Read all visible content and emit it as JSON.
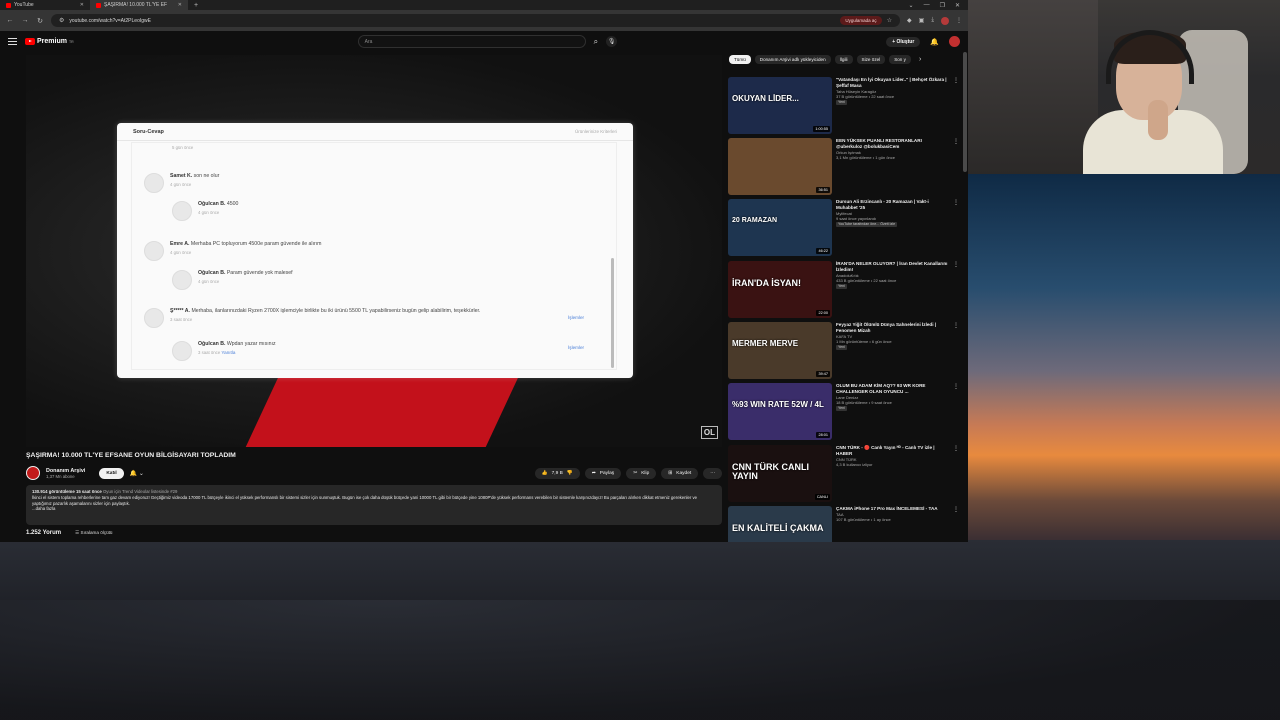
{
  "browser": {
    "tabs": [
      {
        "label": "YouTube",
        "active": false
      },
      {
        "label": "ŞAŞIRMA! 10.000 TL'YE EF",
        "active": true
      }
    ],
    "new_tab": "+",
    "window_controls": [
      "⌄",
      "—",
      "❐",
      "✕"
    ],
    "url": "youtube.com/watch?v=At2PLeoIgwE",
    "app_pill": "Uygulamada aç"
  },
  "header": {
    "brand": "Premium",
    "brand_sup": "TR",
    "search_placeholder": "Ara",
    "create_label": "+ Oluştur"
  },
  "player": {
    "qa": {
      "title": "Soru-Cevap",
      "header_link": "Ürünlerinize Kriterleri",
      "items": [
        {
          "name": "",
          "text": "",
          "time": "5 gün önce"
        },
        {
          "name": "Samet K.",
          "text": "son ne olur",
          "time": "4 gün önce"
        },
        {
          "name": "Oğulcan B.",
          "text": "4500",
          "time": "4 gün önce"
        },
        {
          "name": "Emre A.",
          "text": "Merhaba PC topluyorum 4500e param güvende ile alırım",
          "time": "4 gün önce"
        },
        {
          "name": "Oğulcan B.",
          "text": "Param güvende yok malesef",
          "time": "4 gün önce"
        },
        {
          "name": "Ş***** A.",
          "text": "Merhaba, ilanlarınızdaki Ryzen 2700X işlemciyle birlikte bu iki ürünü 5500 TL yapabilirseniz bugün gelip alabilirim, teşekkürler.",
          "time": "3 saat önce"
        },
        {
          "name": "Oğulcan B.",
          "text": "Wpdan yazar mısınız",
          "time": "3 saat önce"
        }
      ],
      "reply_label": "Yanıtla",
      "replies_label": "İşlemler"
    },
    "overlay_logo": "OL"
  },
  "video": {
    "title": "ŞAŞIRMA! 10.000 TL'YE EFSANE OYUN BİLGİSAYARI TOPLADIM",
    "channel": "Donanım Arşivi",
    "subs": "1,37 Mn abone",
    "join": "Katıl",
    "likes": "7,9 B",
    "share": "Paylaş",
    "clip": "Klip",
    "save": "Kaydet",
    "views_meta": "130.914 görüntüleme  15 saat önce",
    "trend_tag": "Oyun için Trend Videolar listesinde #29",
    "description": "İkinci el sistem toplama rehberlerine tam gaz devam ediyoruz! Geçtiğimiz videoda 17000 TL bütçeyle ikinci el yüksek performanslı bir sistemi sizler için sunmuştuk. Bugün ise çok daha düşük bütçede yani 10000 TL gibi bir bütçede yine 1080P'de yüksek performans verebilen bir sistemle karşınızdayız! Bu parçaları alırken dikkat etmeniz gerekenler ve yaptığımız pazarlık aşamalarını sizler için paylaştık.",
    "more": "...daha fazla",
    "comments_count": "1.252 Yorum",
    "sort_label": "Sıralama ölçütü"
  },
  "chips": [
    "Tümü",
    "Donanım Arşivi adlı yükleyiciden",
    "İlgili",
    "Size özel",
    "Son y"
  ],
  "recommendations": [
    {
      "title": "\"Vatandaşı En İyi Okuyan Lider..\" | Behçet Özkara | Şeffaf Masa",
      "channel": "Taha Hüseyin Karagöz",
      "meta": "37 B görüntüleme • 22 saat önce",
      "badge": "Yeni",
      "duration": "1:00:55",
      "thumb_text": "OKUYAN LİDER...",
      "bg": "#1d2a4a"
    },
    {
      "title": "EEN YÜKSEK PUANLI RESTORANLARI @uberkuloz @bolukbasiCem",
      "channel": "Orkun Işıtmak",
      "meta": "3,1 Mn görüntüleme • 1 gün önce",
      "badge": "",
      "duration": "36:51",
      "thumb_text": "",
      "bg": "#6a4a2e"
    },
    {
      "title": "Dursun Ali Erzincanlı - 20 Ramazan | Vakt-i Muhabbet '25",
      "channel": "Mylifecat",
      "meta": "9 saat önce yayınlandı",
      "badge": "YouTube tarafından öne... Özeti izle",
      "duration": "46:22",
      "thumb_text": "20 RAMAZAN",
      "bg": "#1e3550"
    },
    {
      "title": "İRAN'DA NELER OLUYOR? | İran Devlet Kanallarını İzledim!",
      "channel": "AnadoluKıtık",
      "meta": "433 B görüntüleme • 22 saat önce",
      "badge": "Yeni",
      "duration": "22:00",
      "thumb_text": "İRAN'DA İSYAN!",
      "bg": "#3a1212"
    },
    {
      "title": "Feyyaz Yiğit Ölümlü Dünya Sahnelerini İzledi | Fenomen Mizah",
      "channel": "KAFA TV",
      "meta": "1 Mn görüntüleme • 6 gün önce",
      "badge": "Yeni",
      "duration": "39:47",
      "thumb_text": "MERMER MERVE",
      "bg": "#4a3a2a"
    },
    {
      "title": "OLUM BU ADAM KİM AQ?? 93 WR KORE CHALLENGER OLAN OYUNCU ...",
      "channel": "Lane Denizz",
      "meta": "18 B görüntüleme • 9 saat önce",
      "badge": "Yeni",
      "duration": "28:01",
      "thumb_text": "%93 WIN RATE 52W / 4L",
      "bg": "#3a2d6a"
    },
    {
      "title": "CNN TÜRK - 🔴 Canlı Yayın ᴴᴰ - Canlı TV izle | HABER",
      "channel": "CNN TÜRK",
      "meta": "4,3 B kullanıcı izliyor",
      "badge": "",
      "duration": "CANLI",
      "thumb_text": "CNN TÜRK CANLI YAYIN",
      "bg": "#1a1010"
    },
    {
      "title": "ÇAKMA iPhone 17 Pro Max İNCELEMESİ - TAA",
      "channel": "TAA",
      "meta": "107 B görüntüleme • 1 ay önce",
      "badge": "",
      "duration": "",
      "thumb_text": "EN KALİTELİ ÇAKMA",
      "bg": "#2a3a4a"
    }
  ]
}
